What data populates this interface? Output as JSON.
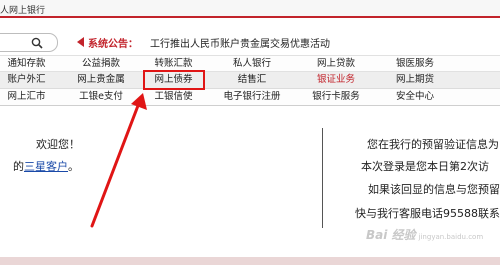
{
  "window": {
    "title": "人网上银行"
  },
  "search": {
    "value": ""
  },
  "notice": {
    "label": "系统公告：",
    "text": "工行推出人民币账户贵金属交易优惠活动"
  },
  "nav": {
    "row1": [
      "通知存款",
      "公益捐款",
      "转账汇款",
      "私人银行",
      "网上贷款",
      "银医服务"
    ],
    "row2": [
      "账户外汇",
      "网上贵金属",
      "网上债券",
      "结售汇",
      "银证业务",
      "网上期货"
    ],
    "row3": [
      "网上汇市",
      "工银e支付",
      "工银信使",
      "电子银行注册",
      "银行卡服务",
      "安全中心"
    ],
    "row2_highlight_color": "#c2232b"
  },
  "welcome": {
    "text": "欢迎您！",
    "prefix": "的",
    "link": "三星客户",
    "suffix": "。"
  },
  "info": {
    "line1": "您在我行的预留验证信息为",
    "line2": "本次登录是您本日第2次访",
    "line3": "如果该回显的信息与您预留",
    "line4": "快与我行客服电话95588联系"
  },
  "watermark": {
    "brand": "Bai 经验",
    "sub": "jingyan.baidu.com"
  },
  "colors": {
    "accent": "#c2232b",
    "annotation": "#e01515",
    "link": "#1a4aa8"
  }
}
